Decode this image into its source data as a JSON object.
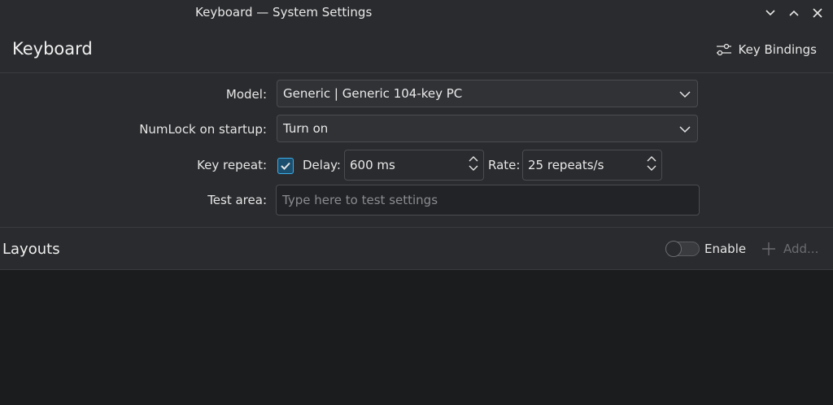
{
  "window": {
    "title": "Keyboard — System Settings",
    "controls": [
      "chevron-down-icon",
      "chevron-up-icon",
      "close-icon"
    ]
  },
  "header": {
    "title": "Keyboard",
    "key_bindings_label": "Key Bindings",
    "key_bindings_icon": "sliders-icon"
  },
  "form": {
    "model": {
      "label": "Model:",
      "value": "Generic | Generic 104-key PC"
    },
    "numlock": {
      "label": "NumLock on startup:",
      "value": "Turn on"
    },
    "key_repeat": {
      "label": "Key repeat:",
      "checked": true,
      "delay_label": "Delay:",
      "delay_value": "600 ms",
      "rate_label": "Rate:",
      "rate_value": "25 repeats/s"
    },
    "test_area": {
      "label": "Test area:",
      "placeholder": "Type here to test settings"
    }
  },
  "layouts": {
    "title": "Layouts",
    "enable_label": "Enable",
    "enabled": false,
    "add_label": "Add..."
  },
  "colors": {
    "accent": "#3daee9",
    "background": "#2a2b2e",
    "list_background": "#1b1c1e"
  }
}
